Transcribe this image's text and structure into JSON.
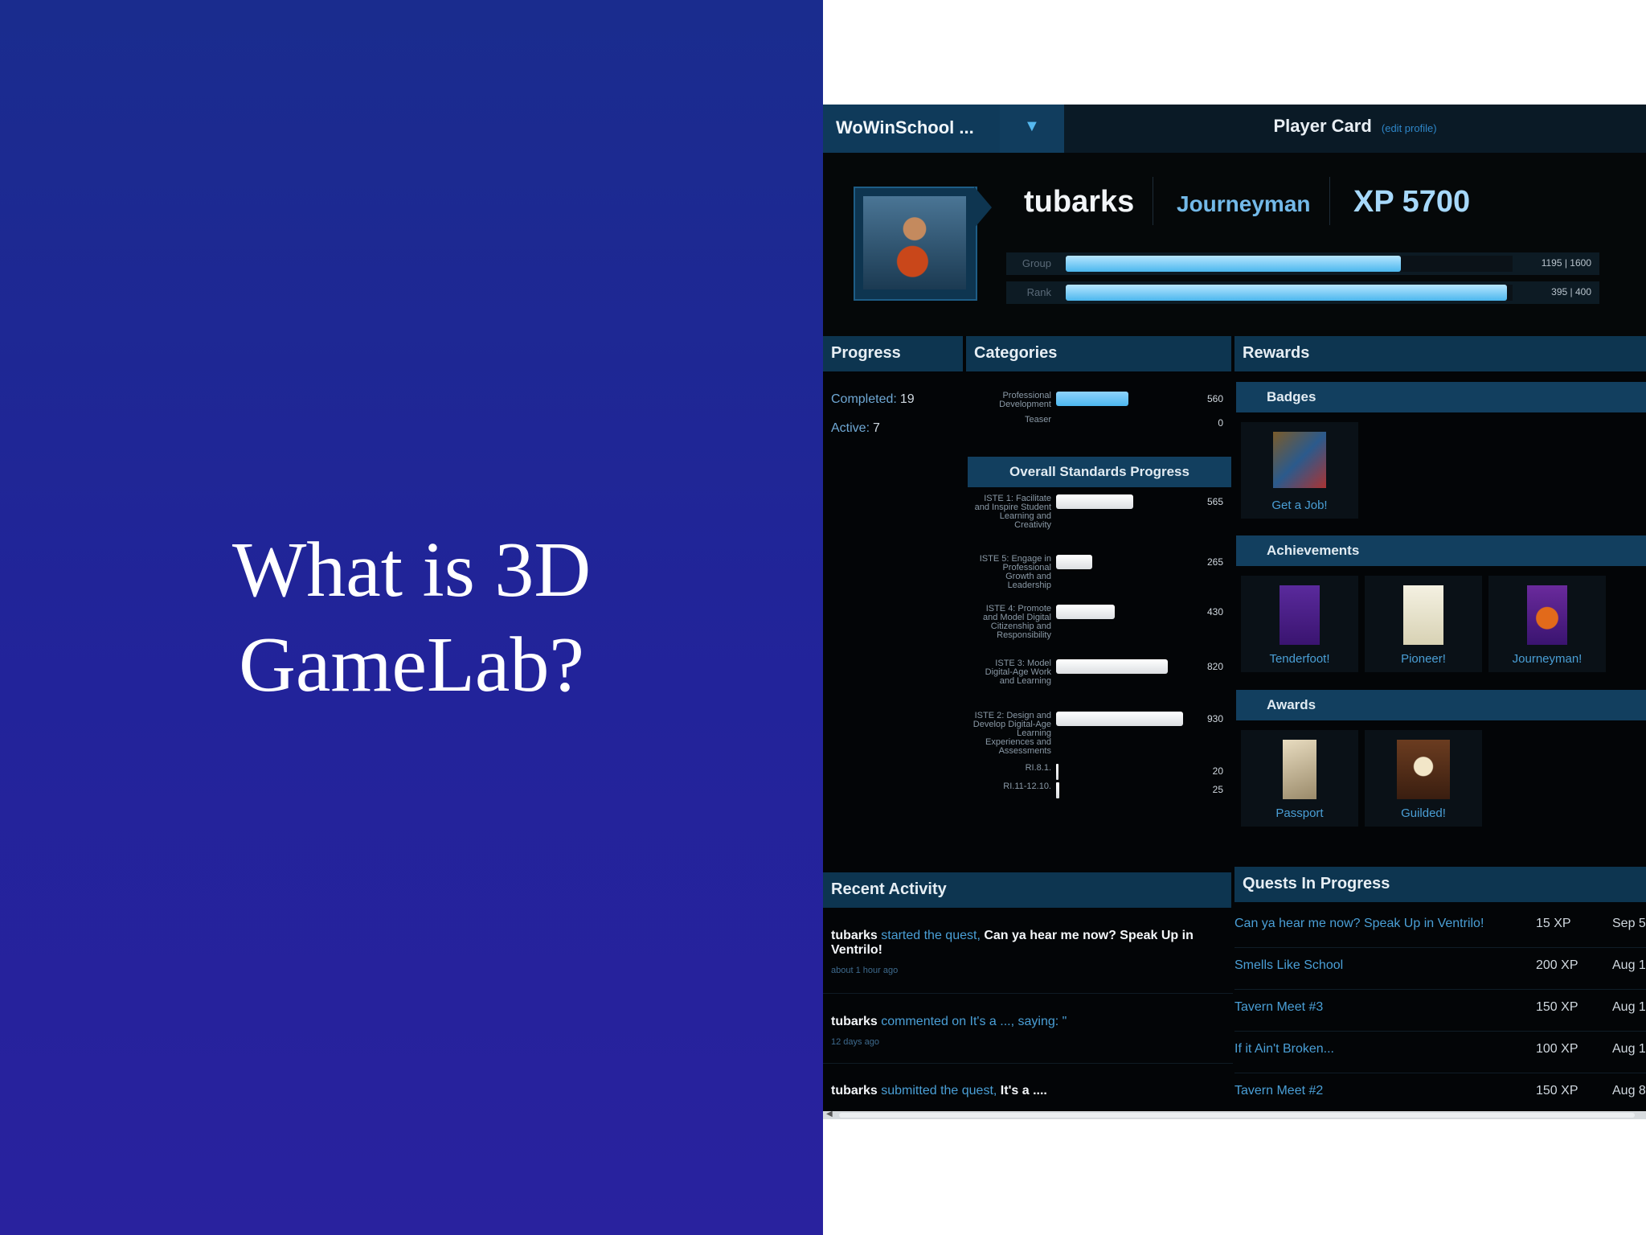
{
  "slide": {
    "title": "What is 3D\nGameLab?"
  },
  "topbar": {
    "site_name": "WoWinSchool ...",
    "dropdown_icon": "▼",
    "card_title": "Player Card",
    "edit_link": "(edit profile)"
  },
  "player": {
    "name": "tubarks",
    "level": "Journeyman",
    "xp_label": "XP 5700"
  },
  "bars": [
    {
      "label": "Group",
      "nums": "1195 | 1600",
      "fraction": 0.75
    },
    {
      "label": "Rank",
      "nums": "395 | 400",
      "fraction": 0.987
    }
  ],
  "progress": {
    "header": "Progress",
    "completed_label": "Completed:",
    "completed_value": "19",
    "active_label": "Active:",
    "active_value": "7"
  },
  "categories": {
    "header": "Categories",
    "items": [
      {
        "label": "Professional Development",
        "value": "560",
        "num": 560
      },
      {
        "label": "Teaser",
        "value": "0",
        "num": 0
      }
    ]
  },
  "chart_data": {
    "type": "bar",
    "title": "Overall Standards Progress",
    "categories": [
      "ISTE 1: Facilitate and Inspire Student Learning and Creativity",
      "ISTE 5: Engage in Professional Growth and Leadership",
      "ISTE 4: Promote and Model Digital Citizenship and Responsibility",
      "ISTE 3: Model Digital-Age Work and Learning",
      "ISTE 2: Design and Develop Digital-Age Learning Experiences and Assessments",
      "RI.8.1.",
      "RI.11-12.10."
    ],
    "values": [
      565,
      265,
      430,
      820,
      930,
      20,
      25
    ],
    "value_labels": [
      "565",
      "265",
      "430",
      "820",
      "930",
      "20",
      "25"
    ],
    "xlim": [
      0,
      1000
    ]
  },
  "rewards": {
    "header": "Rewards",
    "badges_header": "Badges",
    "badges": [
      {
        "label": "Get a Job!"
      }
    ],
    "achievements_header": "Achievements",
    "achievements": [
      {
        "label": "Tenderfoot!"
      },
      {
        "label": "Pioneer!"
      },
      {
        "label": "Journeyman!"
      }
    ],
    "awards_header": "Awards",
    "awards": [
      {
        "label": "Passport"
      },
      {
        "label": "Guilded!"
      }
    ]
  },
  "recent_activity": {
    "header": "Recent Activity",
    "items": [
      {
        "name": "tubarks",
        "verb": "started the quest,",
        "target": "Can ya hear me now? Speak Up in Ventrilo!",
        "when": "about 1 hour ago"
      },
      {
        "name": "tubarks",
        "verb": "commented on It's a ..., saying: \"",
        "target": "",
        "when": "12 days ago"
      },
      {
        "name": "tubarks",
        "verb": "submitted the quest,",
        "target": "It's a ....",
        "when": ""
      }
    ]
  },
  "quests": {
    "header": "Quests In Progress",
    "items": [
      {
        "name": "Can ya hear me now? Speak Up in Ventrilo!",
        "xp": "15 XP",
        "date": "Sep 5"
      },
      {
        "name": "Smells Like School",
        "xp": "200 XP",
        "date": "Aug 1"
      },
      {
        "name": "Tavern Meet #3",
        "xp": "150 XP",
        "date": "Aug 1"
      },
      {
        "name": "If it Ain't Broken...",
        "xp": "100 XP",
        "date": "Aug 1"
      },
      {
        "name": "Tavern Meet #2",
        "xp": "150 XP",
        "date": "Aug 8"
      }
    ]
  },
  "colors": {
    "bar_blue": "#4cb7ee",
    "bar_gray": "#dcdfe2",
    "accent_link": "#4a9fd6",
    "header_bg": "#0d3550"
  }
}
